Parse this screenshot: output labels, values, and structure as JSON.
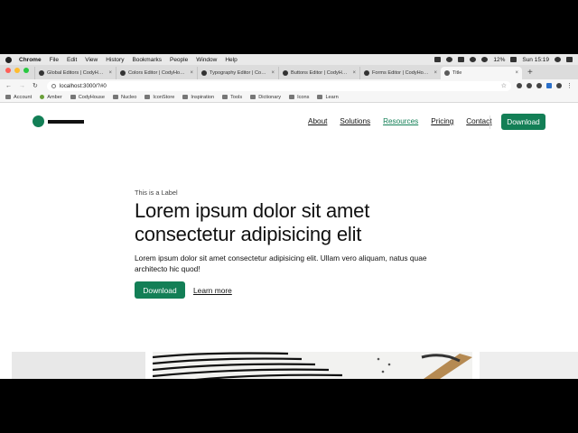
{
  "menubar": {
    "app": "Chrome",
    "items": [
      "File",
      "Edit",
      "View",
      "History",
      "Bookmarks",
      "People",
      "Window",
      "Help"
    ],
    "battery": "12%",
    "clock": "Sun 15:19"
  },
  "tabs": [
    {
      "label": "Global Editors | CodyHouse"
    },
    {
      "label": "Colors Editor | CodyHouse"
    },
    {
      "label": "Typography Editor | CodyHouse"
    },
    {
      "label": "Buttons Editor | CodyHouse"
    },
    {
      "label": "Forms Editor | CodyHouse"
    },
    {
      "label": "Title"
    }
  ],
  "address": {
    "url": "localhost:3000/?#0"
  },
  "bookmarks": [
    "Account",
    "Amber",
    "CodyHouse",
    "Nucleo",
    "IconStore",
    "Inspiration",
    "Tools",
    "Dictionary",
    "Icons",
    "Learn"
  ],
  "header": {
    "nav": [
      "About",
      "Solutions",
      "Resources",
      "Pricing",
      "Contact"
    ],
    "cta": "Download"
  },
  "hero": {
    "label": "This is a Label",
    "title": "Lorem ipsum dolor sit amet consectetur adipisicing elit",
    "text": "Lorem ipsum dolor sit amet consectetur adipisicing elit. Ullam vero aliquam, natus quae architecto hic quod!",
    "primary": "Download",
    "secondary": "Learn more"
  },
  "colors": {
    "accent": "#137f56"
  }
}
